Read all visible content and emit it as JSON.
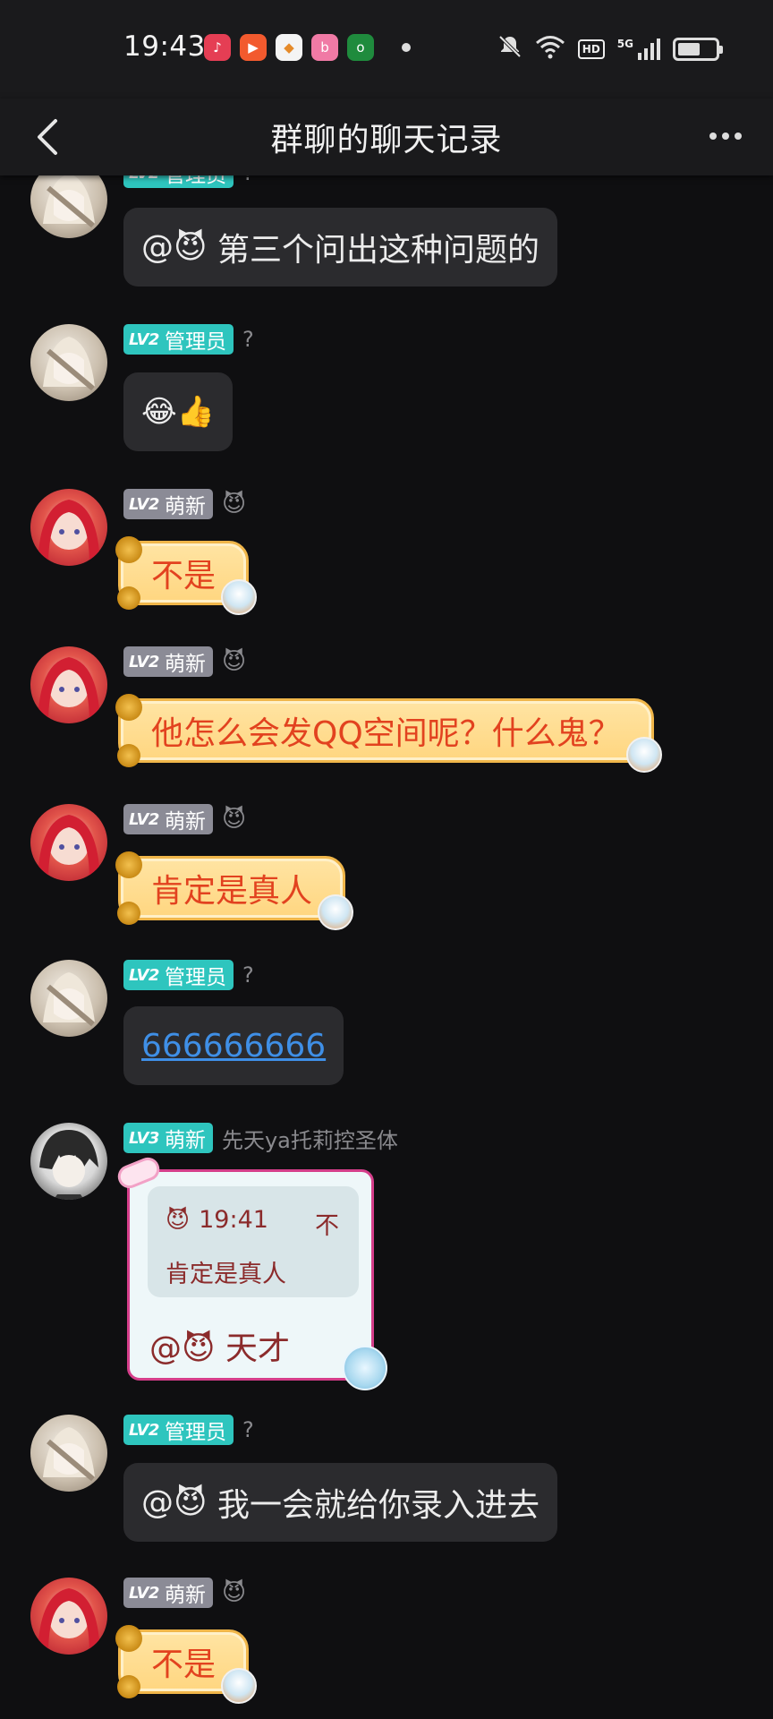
{
  "status_bar": {
    "time": "19:43",
    "network_label": "5G",
    "hd_label": "HD",
    "battery_level": 0.6,
    "app_icons": [
      {
        "name": "music-app-icon",
        "color": "#e53e54",
        "glyph": "♪"
      },
      {
        "name": "video-app-icon",
        "color": "#f25a2e",
        "glyph": "▶"
      },
      {
        "name": "gallery-app-icon",
        "color": "#f4f4f4",
        "glyph": "◆"
      },
      {
        "name": "bilibili-app-icon",
        "color": "#f07aa5",
        "glyph": "b"
      },
      {
        "name": "oppo-app-icon",
        "color": "#1f8b3d",
        "glyph": "o"
      }
    ]
  },
  "header": {
    "title": "群聊的聊天记录",
    "back_icon": "chevron-left-icon",
    "more_icon": "more-icon"
  },
  "badges": {
    "lv2": "LV2",
    "lv3": "LV3",
    "admin": "管理员",
    "new": "萌新"
  },
  "messages": [
    {
      "sender": "?",
      "role": "管理员",
      "level": "LV2",
      "avatar": "admin",
      "text": "第三个问出这种问题的",
      "mention": "@😈"
    },
    {
      "sender": "?",
      "role": "管理员",
      "level": "LV2",
      "avatar": "admin",
      "text": "😂👍"
    },
    {
      "sender": "😈",
      "role": "萌新",
      "level": "LV2",
      "avatar": "red",
      "text": "不是"
    },
    {
      "sender": "😈",
      "role": "萌新",
      "level": "LV2",
      "avatar": "red",
      "text": "他怎么会发QQ空间呢？什么鬼？"
    },
    {
      "sender": "😈",
      "role": "萌新",
      "level": "LV2",
      "avatar": "red",
      "text": "肯定是真人"
    },
    {
      "sender": "?",
      "role": "管理员",
      "level": "LV2",
      "avatar": "admin",
      "text": "666666666"
    },
    {
      "sender": "先天ya托莉控圣体",
      "role": "萌新",
      "level": "LV3",
      "avatar": "dark",
      "quote": {
        "sender": "😈",
        "time": "19:41",
        "flag": "不",
        "text": "肯定是真人"
      },
      "mention": "@😈",
      "text": "天才"
    },
    {
      "sender": "?",
      "role": "管理员",
      "level": "LV2",
      "avatar": "admin",
      "text": "我一会就给你录入进去",
      "mention": "@😈"
    },
    {
      "sender": "😈",
      "role": "萌新",
      "level": "LV2",
      "avatar": "red",
      "text": "不是"
    }
  ]
}
